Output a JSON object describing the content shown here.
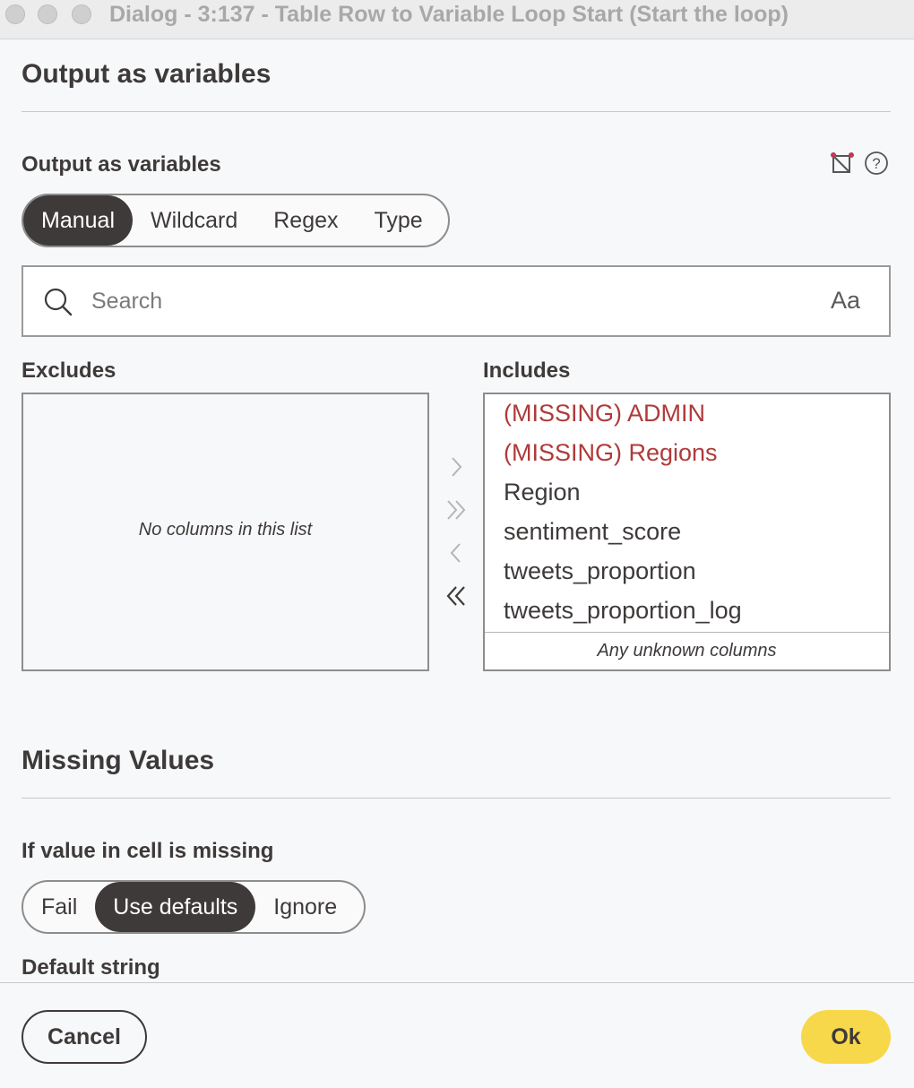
{
  "window": {
    "title": "Dialog - 3:137 - Table Row to Variable Loop Start (Start the loop)"
  },
  "output_section": {
    "heading": "Output as variables",
    "field_label": "Output as variables",
    "modes": [
      "Manual",
      "Wildcard",
      "Regex",
      "Type"
    ],
    "active_mode": "Manual",
    "search": {
      "placeholder": "Search",
      "value": "",
      "case_toggle_label": "Aa"
    },
    "excludes": {
      "title": "Excludes",
      "empty_message": "No columns in this list",
      "items": []
    },
    "includes": {
      "title": "Includes",
      "items": [
        {
          "label": "(MISSING) ADMIN",
          "missing": true
        },
        {
          "label": "(MISSING) Regions",
          "missing": true
        },
        {
          "label": "Region",
          "missing": false
        },
        {
          "label": "sentiment_score",
          "missing": false
        },
        {
          "label": "tweets_proportion",
          "missing": false
        },
        {
          "label": "tweets_proportion_log",
          "missing": false
        }
      ],
      "unknown_columns_label": "Any unknown columns"
    }
  },
  "missing_section": {
    "heading": "Missing Values",
    "field_label": "If value in cell is missing",
    "options": [
      "Fail",
      "Use defaults",
      "Ignore"
    ],
    "active_option": "Use defaults",
    "default_string_label": "Default string"
  },
  "footer": {
    "cancel_label": "Cancel",
    "ok_label": "Ok"
  },
  "colors": {
    "accent_ok": "#f7d84b",
    "active_segment": "#3e3a39",
    "missing_text": "#b03a3a"
  }
}
